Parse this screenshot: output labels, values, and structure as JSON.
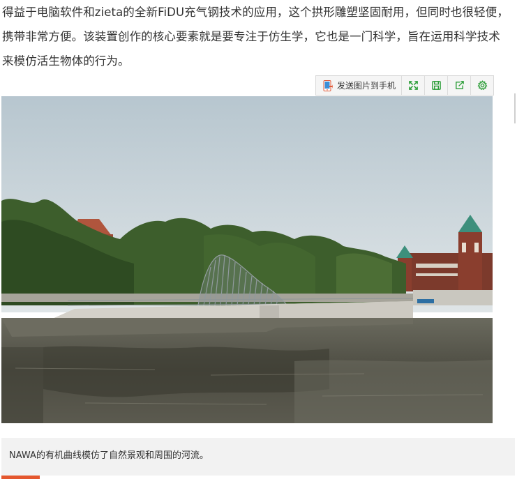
{
  "article": {
    "lines": [
      "得益于电脑软件和zieta的全新FiDU充气钢技术的应用，这个拱形雕塑坚固耐用，但同时也很轻便，",
      "携带非常方便。该装置创作的核心要素就是要专注于仿生学，它也是一门科学，旨在运用科学技术",
      "来模仿活生物体的行为。"
    ]
  },
  "toolbar": {
    "send_label": "发送图片到手机",
    "icons": [
      "fullscreen-icon",
      "save-icon",
      "share-icon",
      "settings-icon"
    ],
    "icon_color": "#2e9e3a"
  },
  "image": {
    "caption": "NAWA的有机曲线模仿了自然景观和周围的河流。"
  },
  "colors": {
    "accent": "#e4572e",
    "caption_bg": "#f2f2f2",
    "text": "#333333"
  }
}
